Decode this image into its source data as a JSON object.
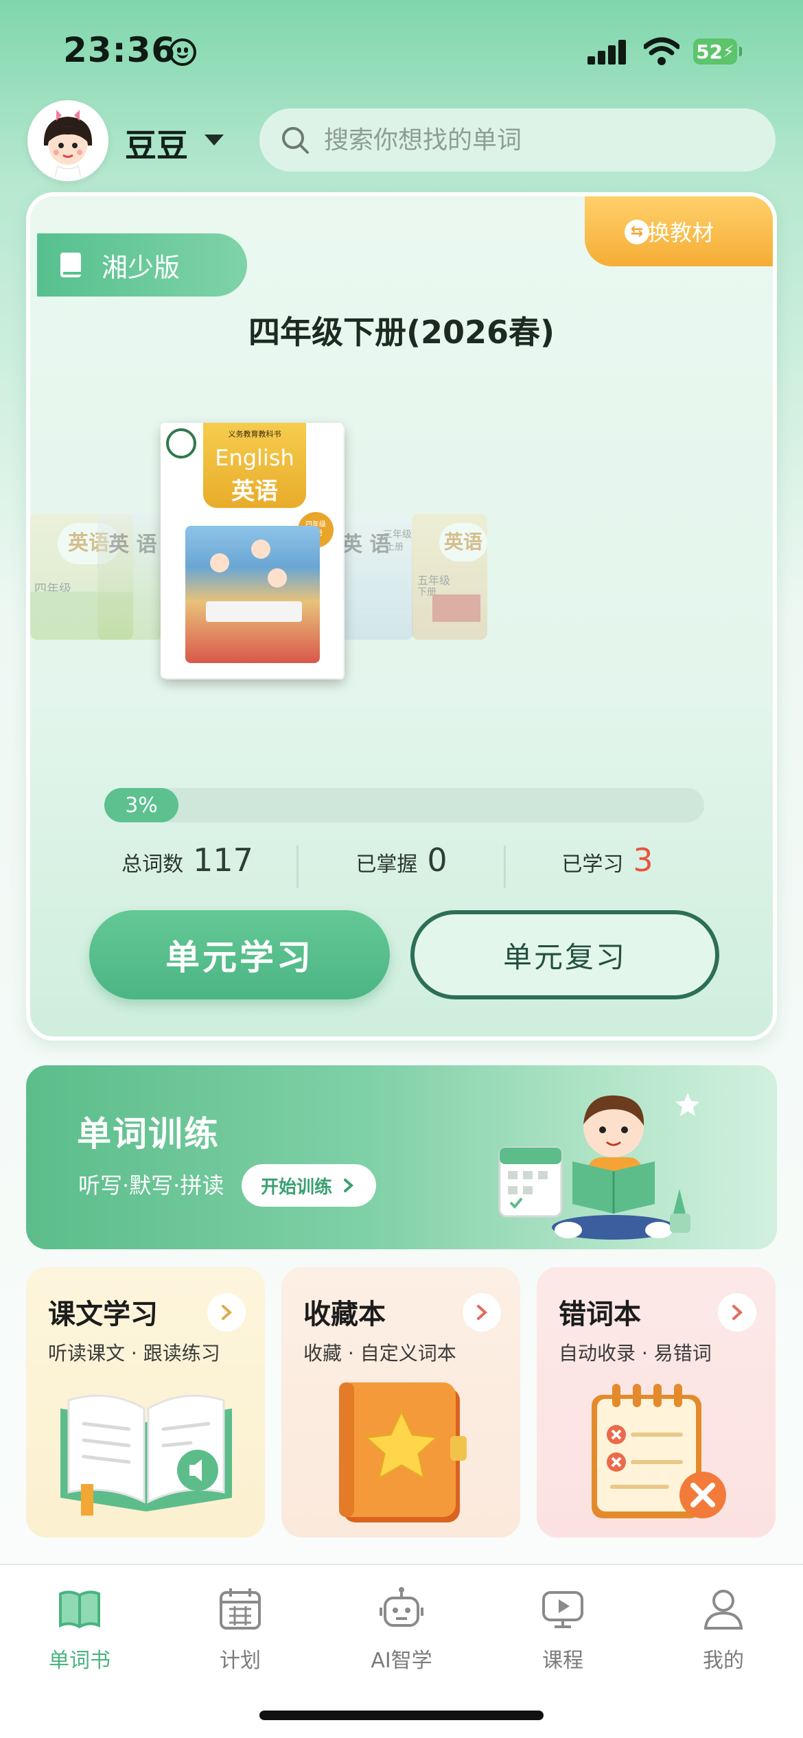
{
  "status_bar": {
    "time": "23:36",
    "battery": "52"
  },
  "header": {
    "user_name": "豆豆",
    "search_placeholder": "搜索你想找的单词"
  },
  "book_card": {
    "edition": "湘少版",
    "switch_label": "切换教材",
    "grade_title": "四年级下册(2026春)",
    "cover": {
      "series": "义务教育教科书",
      "title_en": "English",
      "title_cn": "英语",
      "badge_line1": "四年级",
      "badge_line2": "下册",
      "side_titles": [
        "英语",
        "英 语",
        "英 语",
        "英语"
      ],
      "side_grades": [
        "四年级",
        "三年级",
        "五年级"
      ],
      "side_terms": [
        "",
        "上册",
        "下册"
      ]
    },
    "progress": 3,
    "progress_label": "3%",
    "stats": [
      {
        "label": "总词数",
        "value": "117"
      },
      {
        "label": "已掌握",
        "value": "0"
      },
      {
        "label": "已学习",
        "value": "3"
      }
    ],
    "study_button": "单元学习",
    "review_button": "单元复习"
  },
  "training": {
    "title": "单词训练",
    "subtitle": "听写·默写·拼读",
    "start_label": "开始训练"
  },
  "tiles": [
    {
      "title": "课文学习",
      "subtitle": "听读课文 · 跟读练习"
    },
    {
      "title": "收藏本",
      "subtitle": "收藏 · 自定义词本"
    },
    {
      "title": "错词本",
      "subtitle": "自动收录 · 易错词"
    }
  ],
  "nav": [
    {
      "label": "单词书",
      "icon": "book-icon",
      "active": true
    },
    {
      "label": "计划",
      "icon": "calendar-icon",
      "active": false
    },
    {
      "label": "AI智学",
      "icon": "robot-icon",
      "active": false
    },
    {
      "label": "课程",
      "icon": "video-icon",
      "active": false
    },
    {
      "label": "我的",
      "icon": "user-icon",
      "active": false
    }
  ],
  "colors": {
    "primary": "#4cb584",
    "accent_orange": "#f5ad35",
    "stat_highlight": "#e8533e"
  }
}
